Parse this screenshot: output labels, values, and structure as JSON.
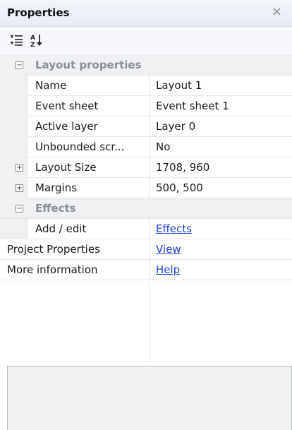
{
  "panel": {
    "title": "Properties",
    "close_glyph": "×"
  },
  "toolbar": {
    "categorized_icon": "categorized-icon",
    "alphabetical_icon": "sort-az-icon"
  },
  "rows": [
    {
      "type": "category",
      "name": "Layout properties",
      "expander": "⊟"
    },
    {
      "type": "prop",
      "name": "Name",
      "value": "Layout 1"
    },
    {
      "type": "prop",
      "name": "Event sheet",
      "value": "Event sheet 1"
    },
    {
      "type": "prop",
      "name": "Active layer",
      "value": "Layer 0"
    },
    {
      "type": "prop",
      "name": "Unbounded scr...",
      "value": "No"
    },
    {
      "type": "prop-expand",
      "name": "Layout Size",
      "value": "1708, 960",
      "expander": "⊞"
    },
    {
      "type": "prop-expand",
      "name": "Margins",
      "value": "500, 500",
      "expander": "⊞"
    },
    {
      "type": "category",
      "name": "Effects",
      "expander": "⊟"
    },
    {
      "type": "prop",
      "name": "Add / edit",
      "value": "Effects",
      "link": true
    },
    {
      "type": "top",
      "name": "Project Properties",
      "value": "View",
      "link": true
    },
    {
      "type": "top",
      "name": "More information",
      "value": "Help",
      "link": true
    }
  ],
  "colors": {
    "link": "#1f3fd6",
    "category_bg": "#eef0f2",
    "category_text": "#8c8f94"
  }
}
